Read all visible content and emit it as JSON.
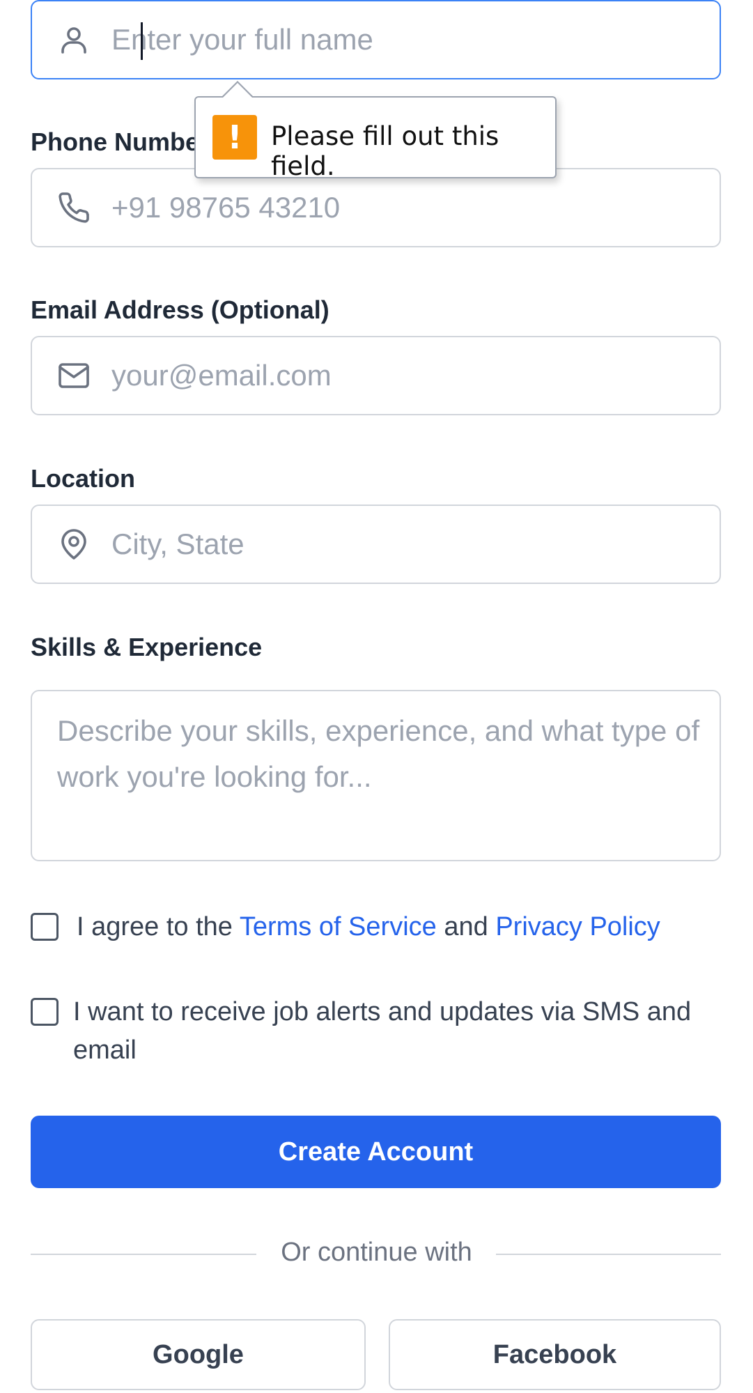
{
  "form": {
    "name_field": {
      "placeholder": "Enter your full name",
      "icon": "user-icon"
    },
    "phone": {
      "label": "Phone Number",
      "placeholder": "+91 98765 43210",
      "icon": "phone-icon"
    },
    "email": {
      "label": "Email Address (Optional)",
      "placeholder": "your@email.com",
      "icon": "mail-icon"
    },
    "location": {
      "label": "Location",
      "placeholder": "City, State",
      "icon": "map-pin-icon"
    },
    "skills": {
      "label": "Skills & Experience",
      "placeholder": "Describe your skills, experience, and what type of work you're looking for..."
    },
    "terms": {
      "prefix": "I agree to the",
      "terms_link": "Terms of Service",
      "and": "and",
      "privacy_link": "Privacy Policy"
    },
    "alerts": {
      "text": "I want to receive job alerts and updates via SMS and email"
    },
    "submit_label": "Create Account",
    "divider_text": "Or continue with",
    "social": {
      "google": "Google",
      "facebook": "Facebook"
    }
  },
  "validation_tooltip": {
    "message": "Please fill out this field.",
    "icon": "warning-icon"
  },
  "colors": {
    "primary": "#2563eb",
    "focus_border": "#3b82f6",
    "warning": "#f7930a",
    "placeholder": "#9ca3af"
  }
}
